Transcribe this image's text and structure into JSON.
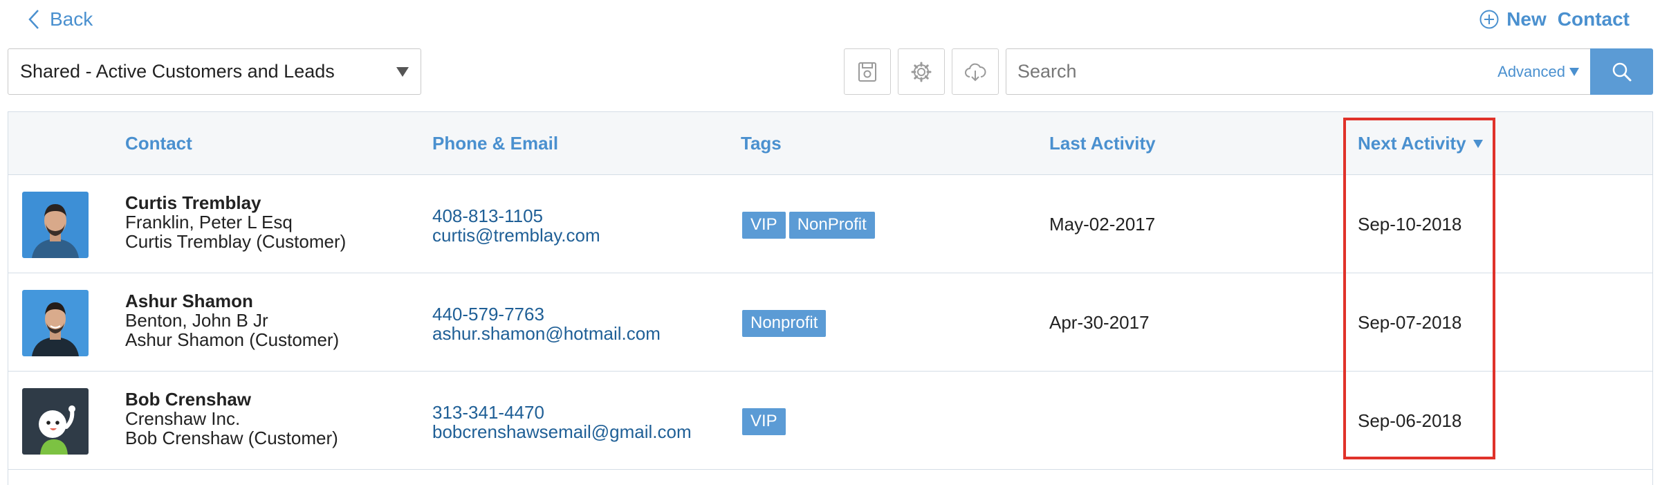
{
  "nav": {
    "back_label": "Back",
    "new_label": "New",
    "contact_label": "Contact"
  },
  "toolbar": {
    "view_selected": "Shared - Active Customers and Leads",
    "search_placeholder": "Search",
    "advanced_label": "Advanced"
  },
  "table": {
    "headers": {
      "contact": "Contact",
      "phone_email": "Phone & Email",
      "tags": "Tags",
      "last_activity": "Last Activity",
      "next_activity": "Next Activity"
    },
    "sorted_column": "Next Activity",
    "sort_direction": "descending",
    "rows": [
      {
        "name": "Curtis Tremblay",
        "company": "Franklin, Peter L Esq",
        "detail": "Curtis Tremblay (Customer)",
        "phone": "408-813-1105",
        "email": "curtis@tremblay.com",
        "tags": [
          "VIP",
          "NonProfit"
        ],
        "last_activity": "May-02-2017",
        "next_activity": "Sep-10-2018",
        "avatar": "photo-avatar-icon"
      },
      {
        "name": "Ashur Shamon",
        "company": "Benton, John B Jr",
        "detail": "Ashur Shamon (Customer)",
        "phone": "440-579-7763",
        "email": "ashur.shamon@hotmail.com",
        "tags": [
          "Nonprofit"
        ],
        "last_activity": "Apr-30-2017",
        "next_activity": "Sep-07-2018",
        "avatar": "photo-avatar-icon"
      },
      {
        "name": "Bob Crenshaw",
        "company": "Crenshaw Inc.",
        "detail": "Bob Crenshaw (Customer)",
        "phone": "313-341-4470",
        "email": "bobcrenshawsemail@gmail.com",
        "tags": [
          "VIP"
        ],
        "last_activity": "",
        "next_activity": "Sep-06-2018",
        "avatar": "cartoon-avatar-icon"
      }
    ]
  },
  "colors": {
    "link": "#4a90cf",
    "tag_bg": "#5b9bd5",
    "highlight": "#e0322a"
  }
}
